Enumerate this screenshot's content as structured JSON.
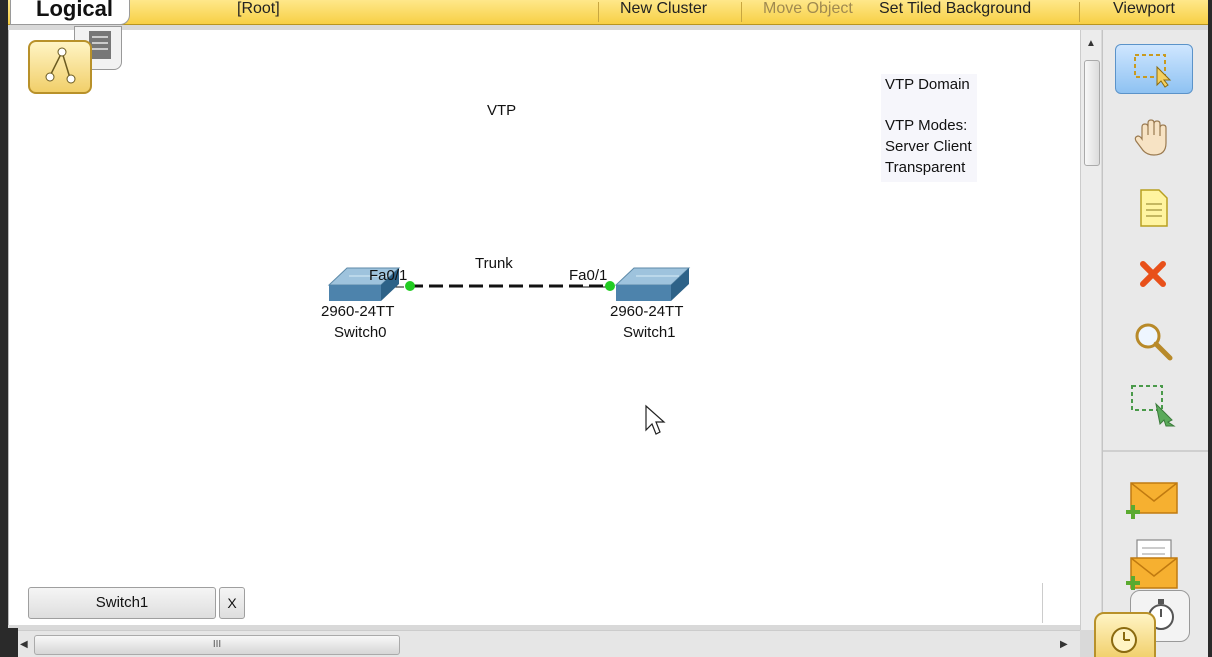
{
  "menu": {
    "logical": "Logical",
    "root": "[Root]",
    "new_cluster": "New Cluster",
    "move_object": "Move Object",
    "set_tiled_background": "Set Tiled Background",
    "viewport": "Viewport"
  },
  "workspace": {
    "vtp_note": "VTP",
    "notes": {
      "line1": "VTP Domain",
      "line2": "VTP Modes:",
      "line3": "Server Client",
      "line4": "Transparent"
    },
    "link_label": "Trunk",
    "devices": [
      {
        "model": "2960-24TT",
        "name": "Switch0",
        "port": "Fa0/1"
      },
      {
        "model": "2960-24TT",
        "name": "Switch1",
        "port": "Fa0/1"
      }
    ]
  },
  "bottom": {
    "device_button": "Switch1",
    "close_button": "X",
    "hscroll_grip": "III"
  },
  "tools": [
    "select-icon",
    "hand-icon",
    "note-icon",
    "delete-icon",
    "inspect-icon",
    "resize-icon",
    "add-pdu-icon",
    "add-complex-pdu-icon"
  ],
  "colors": {
    "menu_bar": "#f7cf45",
    "link_up": "#22cc22",
    "switch": "#5a8fb0"
  }
}
